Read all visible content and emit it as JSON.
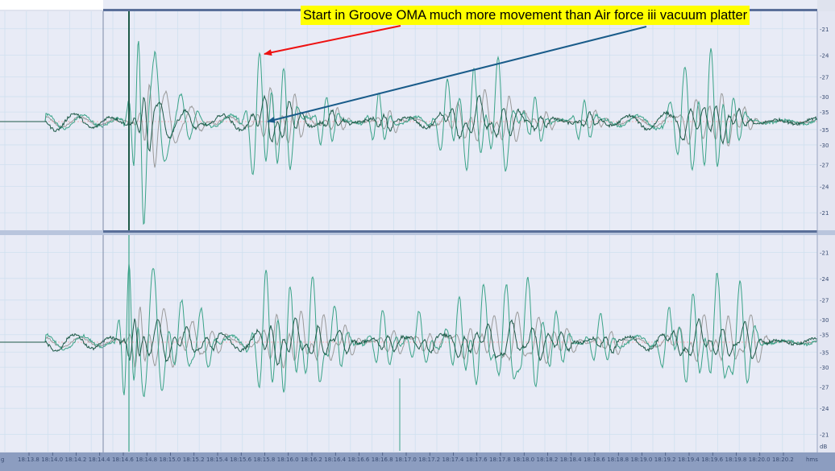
{
  "annotation": {
    "text": "Start in Groove OMA much more movement than Air force iii vacuum platter"
  },
  "time_axis": {
    "edge_label": "g",
    "unit_label": "hms",
    "labels": [
      "18:13.8",
      "18:14.0",
      "18:14.2",
      "18:14.4",
      "18:14.6",
      "18:14.8",
      "18:15.0",
      "18:15.2",
      "18:15.4",
      "18:15.6",
      "18:15.8",
      "18:16.0",
      "18:16.2",
      "18:16.4",
      "18:16.6",
      "18:16.8",
      "18:17.0",
      "18:17.2",
      "18:17.4",
      "18:17.6",
      "18:17.8",
      "18:18.0",
      "18:18.2",
      "18:18.4",
      "18:18.6",
      "18:18.8",
      "18:19.0",
      "18:19.2",
      "18:19.4",
      "18:19.6",
      "18:19.8",
      "18:20.0",
      "18:20.2"
    ]
  },
  "db_scale": {
    "unit": "dB",
    "upper": [
      "-21",
      "-24",
      "-27",
      "-30",
      "-35",
      "-35",
      "-30",
      "-27",
      "-24",
      "-21"
    ],
    "lower": [
      "-21",
      "-24",
      "-27",
      "-30",
      "-35",
      "-35",
      "-30",
      "-27",
      "-24",
      "-21"
    ]
  },
  "colors": {
    "channel_background": "#e8ebf6",
    "waveform_light": "#3aa388",
    "waveform_dark": "#1e5a48",
    "waveform_gray": "#9a9a9a",
    "center_line": "#f0a0a0",
    "divider": "#5a6f99",
    "arrow_red": "#ee1111",
    "arrow_blue": "#1a5c8a",
    "highlight": "#ffff00"
  },
  "icons": {
    "arrow_to_groove": "red-arrow",
    "arrow_to_platter": "blue-arrow"
  }
}
